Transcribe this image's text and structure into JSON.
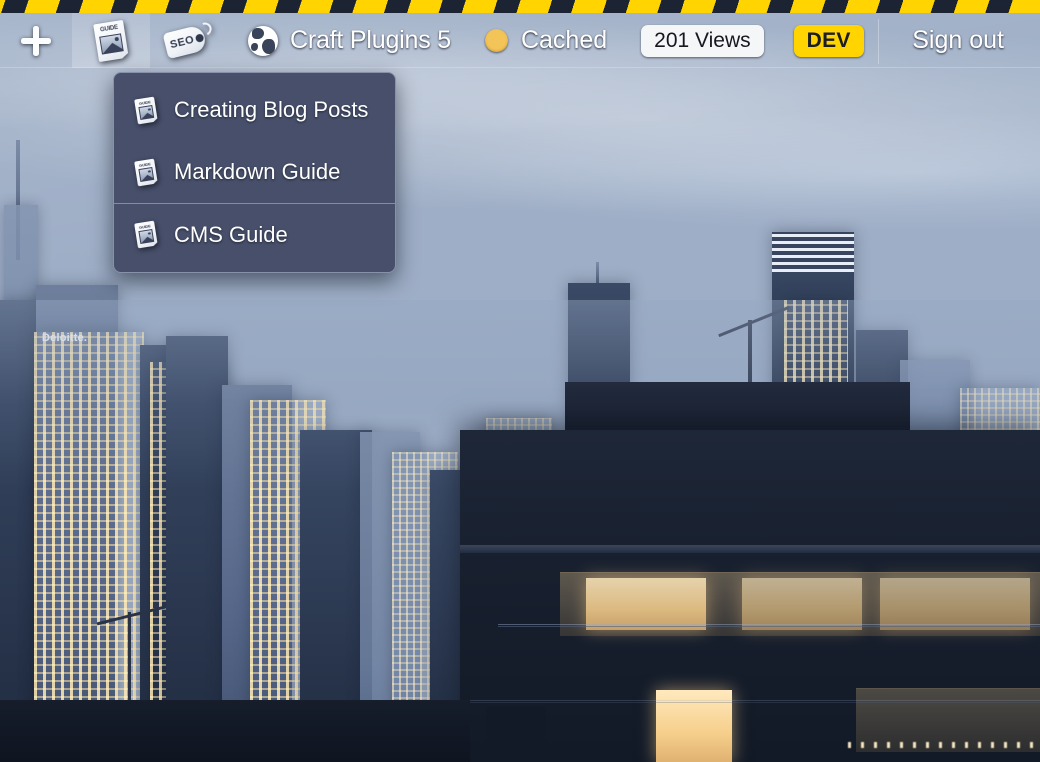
{
  "window": {
    "title": "Craft Plugins 5"
  },
  "hazard_bar": {
    "name": "dev-hazard-stripes",
    "stripe_color": "#ffd400",
    "base_color": "#1c2333"
  },
  "toolbar": {
    "background_top_color": "#1c2331",
    "background_bottom_color": "#97a2b6",
    "add_button": {
      "icon": "plus-icon",
      "label": "+"
    },
    "guide_button": {
      "icon": "guide-document-icon",
      "icon_word": "GUIDE",
      "active": true
    },
    "seo_button": {
      "icon": "seo-tag-icon",
      "icon_word": "SEO"
    },
    "site": {
      "icon": "globe-icon",
      "title": "Craft Plugins 5"
    },
    "cache_status": {
      "icon": "status-dot-icon",
      "dot_color": "#f3c457",
      "label": "Cached"
    },
    "views": {
      "label": "201 Views",
      "background_color": "#f5f6f8",
      "text_color": "#15181f"
    },
    "environment": {
      "label": "DEV",
      "background_color": "#ffd400",
      "text_color": "#1b1d22"
    },
    "sign_out": {
      "label": "Sign out"
    }
  },
  "dropdown": {
    "name": "guide-dropdown-menu",
    "background_color": "#474f6a",
    "items": [
      {
        "label": "Creating Blog Posts",
        "icon": "guide-document-icon",
        "icon_word": "GUIDE",
        "separator_above": false
      },
      {
        "label": "Markdown Guide",
        "icon": "guide-document-icon",
        "icon_word": "GUIDE",
        "separator_above": false
      },
      {
        "label": "CMS Guide",
        "icon": "guide-document-icon",
        "icon_word": "GUIDE",
        "separator_above": true
      }
    ]
  },
  "background": {
    "description": "Dusk cityscape photograph with lit skyscrapers and a dark penthouse building",
    "building_sign": "Deloitte.",
    "sky_color": "#a6b5cb",
    "ground_color": "#121828"
  }
}
